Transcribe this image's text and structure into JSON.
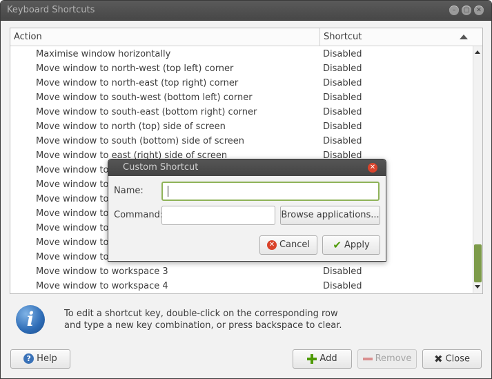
{
  "window": {
    "title": "Keyboard Shortcuts"
  },
  "tree": {
    "col_action": "Action",
    "col_shortcut": "Shortcut",
    "rows": [
      {
        "action": "Maximise window horizontally",
        "shortcut": "Disabled"
      },
      {
        "action": "Move window to north-west (top left) corner",
        "shortcut": "Disabled"
      },
      {
        "action": "Move window to north-east (top right) corner",
        "shortcut": "Disabled"
      },
      {
        "action": "Move window to south-west (bottom left) corner",
        "shortcut": "Disabled"
      },
      {
        "action": "Move window to south-east (bottom right) corner",
        "shortcut": "Disabled"
      },
      {
        "action": "Move window to north (top) side of screen",
        "shortcut": "Disabled"
      },
      {
        "action": "Move window to south (bottom) side of screen",
        "shortcut": "Disabled"
      },
      {
        "action": "Move window to east (right) side of screen",
        "shortcut": "Disabled"
      },
      {
        "action": "Move window to",
        "shortcut": ""
      },
      {
        "action": "Move window to",
        "shortcut": ""
      },
      {
        "action": "Move window to",
        "shortcut": ""
      },
      {
        "action": "Move window to",
        "shortcut": ""
      },
      {
        "action": "Move window to",
        "shortcut": ""
      },
      {
        "action": "Move window to",
        "shortcut": ""
      },
      {
        "action": "Move window to",
        "shortcut": ""
      },
      {
        "action": "Move window to workspace 3",
        "shortcut": "Disabled"
      },
      {
        "action": "Move window to workspace 4",
        "shortcut": "Disabled"
      }
    ]
  },
  "hint": {
    "line1": "To edit a shortcut key, double-click on the corresponding row",
    "line2": "and type a new key combination, or press backspace to clear."
  },
  "buttons": {
    "help": "Help",
    "add": "Add",
    "remove": "Remove",
    "close": "Close"
  },
  "dialog": {
    "title": "Custom Shortcut",
    "name_label": "Name:",
    "name_value": "",
    "command_label": "Command:",
    "command_value": "",
    "browse": "Browse applications...",
    "cancel": "Cancel",
    "apply": "Apply"
  },
  "icons": {
    "info": "info-icon",
    "help": "help-icon",
    "add": "plus-icon",
    "remove": "minus-icon",
    "close": "x-icon",
    "cancel": "cancel-icon",
    "apply": "checkmark-icon"
  },
  "colors": {
    "accent": "#7d9b4a",
    "close_red": "#d9432b",
    "info_blue": "#2d6bb5"
  }
}
